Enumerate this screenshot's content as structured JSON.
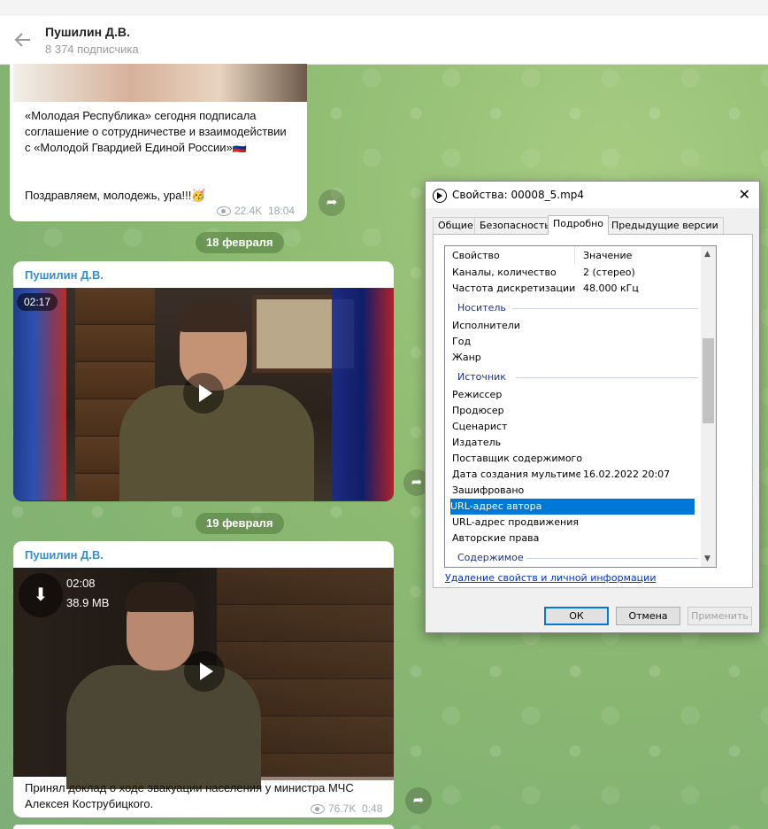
{
  "header": {
    "title": "Пушилин Д.В.",
    "subtitle": "8 374 подписчика"
  },
  "message1": {
    "text": "«Молодая Республика» сегодня подписала соглашение о сотрудничестве и взаимодействии с «Молодой Гвардией Единой России»🇷🇺",
    "text2": "Поздравляем, молодежь, ура!!!🥳",
    "views": "22.4K",
    "time": "18:04"
  },
  "date1": "18 февраля",
  "message2": {
    "sender": "Пушилин Д.В.",
    "duration": "02:17"
  },
  "date2": "19 февраля",
  "message3": {
    "sender": "Пушилин Д.В.",
    "duration": "02:08",
    "size": "38.9 MB",
    "text": "Принял доклад о ходе эвакуации населения у министра МЧС Алексея Кострубицкого.",
    "views": "76.7K",
    "time": "0:48"
  },
  "dialog": {
    "title": "Свойства: 00008_5.mp4",
    "tabs": [
      "Общие",
      "Безопасность",
      "Подробно",
      "Предыдущие версии"
    ],
    "active_tab": "Подробно",
    "columns": {
      "property": "Свойство",
      "value": "Значение"
    },
    "rows": [
      {
        "property": "Каналы, количество",
        "value": "2 (стерео)"
      },
      {
        "property": "Частота дискретизации",
        "value": "48.000 кГц"
      }
    ],
    "group_media": "Носитель",
    "media_rows": [
      "Исполнители",
      "Год",
      "Жанр"
    ],
    "group_source": "Источник",
    "source_rows": [
      {
        "property": "Режиссер",
        "value": ""
      },
      {
        "property": "Продюсер",
        "value": ""
      },
      {
        "property": "Сценарист",
        "value": ""
      },
      {
        "property": "Издатель",
        "value": ""
      },
      {
        "property": "Поставщик содержимого",
        "value": ""
      },
      {
        "property": "Дата создания мультиме...",
        "value": "16.02.2022 20:07"
      },
      {
        "property": "Зашифровано",
        "value": ""
      },
      {
        "property": "URL-адрес автора",
        "value": ""
      },
      {
        "property": "URL-адрес продвижения",
        "value": ""
      },
      {
        "property": "Авторские права",
        "value": ""
      }
    ],
    "group_content": "Содержимое",
    "link": "Удаление свойств и личной информации",
    "buttons": {
      "ok": "ОК",
      "cancel": "Отмена",
      "apply": "Применить"
    }
  }
}
